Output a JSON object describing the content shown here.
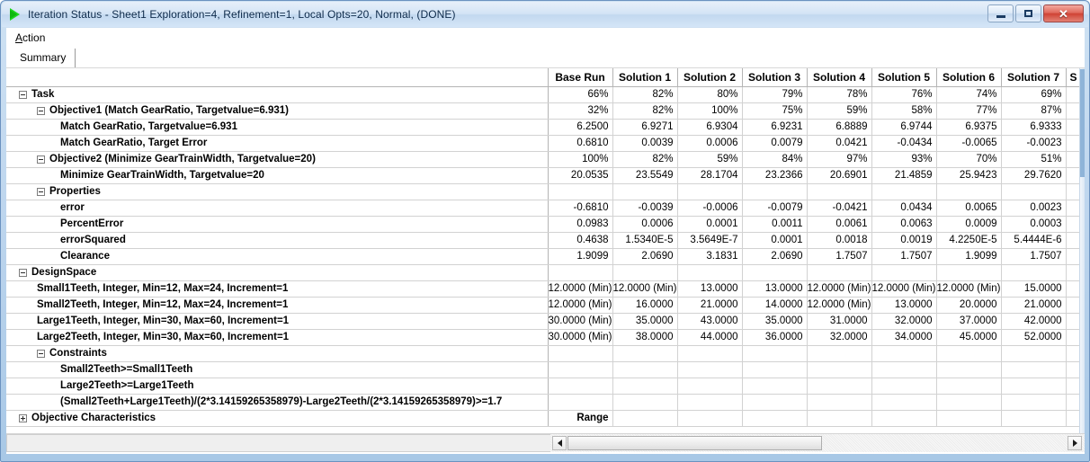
{
  "window": {
    "title": "Iteration Status - Sheet1 Exploration=4, Refinement=1, Local Opts=20, Normal, (DONE)",
    "app_icon": "play-triangle-icon",
    "minimize_label": "–",
    "maximize_label": "□",
    "close_label": "✕"
  },
  "menubar": {
    "items": [
      {
        "label_pre": "",
        "accel": "A",
        "label_post": "ction"
      }
    ]
  },
  "tabs": [
    {
      "label": "Summary",
      "selected": true
    }
  ],
  "grid": {
    "tree_header": "",
    "columns": [
      "Base Run",
      "Solution 1",
      "Solution 2",
      "Solution 3",
      "Solution 4",
      "Solution 5",
      "Solution 6",
      "Solution 7",
      "S"
    ],
    "rows": [
      {
        "label": "Task",
        "indent": 0,
        "expander": "minus",
        "bold": true,
        "values": [
          "66%",
          "82%",
          "80%",
          "79%",
          "78%",
          "76%",
          "74%",
          "69%",
          ""
        ],
        "red": [
          false,
          false,
          false,
          false,
          false,
          false,
          false,
          false,
          false
        ]
      },
      {
        "label": "Objective1 (Match GearRatio, Targetvalue=6.931)",
        "indent": 1,
        "expander": "minus",
        "bold": true,
        "values": [
          "32%",
          "82%",
          "100%",
          "75%",
          "59%",
          "58%",
          "77%",
          "87%",
          ""
        ],
        "red": [
          false,
          false,
          false,
          false,
          false,
          false,
          false,
          false,
          false
        ]
      },
      {
        "label": "Match GearRatio, Targetvalue=6.931",
        "indent": 2,
        "expander": "none",
        "bold": true,
        "values": [
          "6.2500",
          "6.9271",
          "6.9304",
          "6.9231",
          "6.8889",
          "6.9744",
          "6.9375",
          "6.9333",
          ""
        ],
        "red": [
          false,
          false,
          false,
          false,
          false,
          false,
          false,
          false,
          false
        ]
      },
      {
        "label": "Match GearRatio, Target Error",
        "indent": 2,
        "expander": "none",
        "bold": true,
        "values": [
          "0.6810",
          "0.0039",
          "0.0006",
          "0.0079",
          "0.0421",
          "-0.0434",
          "-0.0065",
          "-0.0023",
          ""
        ],
        "red": [
          false,
          false,
          false,
          false,
          false,
          false,
          false,
          false,
          false
        ]
      },
      {
        "label": "Objective2 (Minimize GearTrainWidth, Targetvalue=20)",
        "indent": 1,
        "expander": "minus",
        "bold": true,
        "values": [
          "100%",
          "82%",
          "59%",
          "84%",
          "97%",
          "93%",
          "70%",
          "51%",
          ""
        ],
        "red": [
          false,
          false,
          false,
          false,
          false,
          false,
          false,
          false,
          false
        ]
      },
      {
        "label": "Minimize GearTrainWidth, Targetvalue=20",
        "indent": 2,
        "expander": "none",
        "bold": true,
        "values": [
          "20.0535",
          "23.5549",
          "28.1704",
          "23.2366",
          "20.6901",
          "21.4859",
          "25.9423",
          "29.7620",
          ""
        ],
        "red": [
          false,
          false,
          false,
          false,
          false,
          false,
          false,
          false,
          false
        ]
      },
      {
        "label": "Properties",
        "indent": 1,
        "expander": "minus",
        "bold": true,
        "values": [
          "",
          "",
          "",
          "",
          "",
          "",
          "",
          "",
          ""
        ],
        "red": [
          false,
          false,
          false,
          false,
          false,
          false,
          false,
          false,
          false
        ]
      },
      {
        "label": "error",
        "indent": 2,
        "expander": "none",
        "bold": true,
        "values": [
          "-0.6810",
          "-0.0039",
          "-0.0006",
          "-0.0079",
          "-0.0421",
          "0.0434",
          "0.0065",
          "0.0023",
          ""
        ],
        "red": [
          false,
          false,
          false,
          false,
          false,
          false,
          false,
          false,
          false
        ]
      },
      {
        "label": "PercentError",
        "indent": 2,
        "expander": "none",
        "bold": true,
        "values": [
          "0.0983",
          "0.0006",
          "0.0001",
          "0.0011",
          "0.0061",
          "0.0063",
          "0.0009",
          "0.0003",
          ""
        ],
        "red": [
          false,
          false,
          false,
          false,
          false,
          false,
          false,
          false,
          false
        ]
      },
      {
        "label": "errorSquared",
        "indent": 2,
        "expander": "none",
        "bold": true,
        "values": [
          "0.4638",
          "1.5340E-5",
          "3.5649E-7",
          "0.0001",
          "0.0018",
          "0.0019",
          "4.2250E-5",
          "5.4444E-6",
          ""
        ],
        "red": [
          false,
          false,
          false,
          false,
          false,
          false,
          false,
          false,
          false
        ]
      },
      {
        "label": "Clearance",
        "indent": 2,
        "expander": "none",
        "bold": true,
        "values": [
          "1.9099",
          "2.0690",
          "3.1831",
          "2.0690",
          "1.7507",
          "1.7507",
          "1.9099",
          "1.7507",
          ""
        ],
        "red": [
          false,
          false,
          false,
          false,
          false,
          false,
          false,
          false,
          false
        ]
      },
      {
        "label": "DesignSpace",
        "indent": 0,
        "expander": "minus",
        "bold": true,
        "values": [
          "",
          "",
          "",
          "",
          "",
          "",
          "",
          "",
          ""
        ],
        "red": [
          false,
          false,
          false,
          false,
          false,
          false,
          false,
          false,
          false
        ]
      },
      {
        "label": "Small1Teeth, Integer, Min=12, Max=24, Increment=1",
        "indent": 1,
        "expander": "none",
        "bold": true,
        "values": [
          "12.0000 (Min)",
          "12.0000 (Min)",
          "13.0000",
          "13.0000",
          "12.0000 (Min)",
          "12.0000 (Min)",
          "12.0000 (Min)",
          "15.0000",
          ""
        ],
        "red": [
          true,
          true,
          false,
          false,
          true,
          true,
          true,
          false,
          false
        ]
      },
      {
        "label": "Small2Teeth, Integer, Min=12, Max=24, Increment=1",
        "indent": 1,
        "expander": "none",
        "bold": true,
        "values": [
          "12.0000 (Min)",
          "16.0000",
          "21.0000",
          "14.0000",
          "12.0000 (Min)",
          "13.0000",
          "20.0000",
          "21.0000",
          ""
        ],
        "red": [
          true,
          false,
          false,
          false,
          true,
          false,
          false,
          false,
          false
        ]
      },
      {
        "label": "Large1Teeth, Integer, Min=30, Max=60, Increment=1",
        "indent": 1,
        "expander": "none",
        "bold": true,
        "values": [
          "30.0000 (Min)",
          "35.0000",
          "43.0000",
          "35.0000",
          "31.0000",
          "32.0000",
          "37.0000",
          "42.0000",
          ""
        ],
        "red": [
          true,
          false,
          false,
          false,
          false,
          false,
          false,
          false,
          false
        ]
      },
      {
        "label": "Large2Teeth, Integer, Min=30, Max=60, Increment=1",
        "indent": 1,
        "expander": "none",
        "bold": true,
        "values": [
          "30.0000 (Min)",
          "38.0000",
          "44.0000",
          "36.0000",
          "32.0000",
          "34.0000",
          "45.0000",
          "52.0000",
          ""
        ],
        "red": [
          true,
          false,
          false,
          false,
          false,
          false,
          false,
          false,
          false
        ]
      },
      {
        "label": "Constraints",
        "indent": 1,
        "expander": "minus",
        "bold": true,
        "values": [
          "",
          "",
          "",
          "",
          "",
          "",
          "",
          "",
          ""
        ],
        "red": [
          false,
          false,
          false,
          false,
          false,
          false,
          false,
          false,
          false
        ]
      },
      {
        "label": "Small2Teeth>=Small1Teeth",
        "indent": 2,
        "expander": "none",
        "bold": true,
        "values": [
          "",
          "",
          "",
          "",
          "",
          "",
          "",
          "",
          ""
        ],
        "red": [
          false,
          false,
          false,
          false,
          false,
          false,
          false,
          false,
          false
        ]
      },
      {
        "label": "Large2Teeth>=Large1Teeth",
        "indent": 2,
        "expander": "none",
        "bold": true,
        "values": [
          "",
          "",
          "",
          "",
          "",
          "",
          "",
          "",
          ""
        ],
        "red": [
          false,
          false,
          false,
          false,
          false,
          false,
          false,
          false,
          false
        ]
      },
      {
        "label": "(Small2Teeth+Large1Teeth)/(2*3.14159265358979)-Large2Teeth/(2*3.14159265358979)>=1.7",
        "indent": 2,
        "expander": "none",
        "bold": true,
        "values": [
          "",
          "",
          "",
          "",
          "",
          "",
          "",
          "",
          ""
        ],
        "red": [
          false,
          false,
          false,
          false,
          false,
          false,
          false,
          false,
          false
        ]
      },
      {
        "label": "Objective Characteristics",
        "indent": 0,
        "expander": "plus",
        "bold": true,
        "values": [
          "Range",
          "",
          "",
          "",
          "",
          "",
          "",
          "",
          ""
        ],
        "red": [
          false,
          false,
          false,
          false,
          false,
          false,
          false,
          false,
          false
        ],
        "center": [
          true,
          false,
          false,
          false,
          false,
          false,
          false,
          false,
          false
        ]
      }
    ]
  },
  "scrollbar": {
    "left_arrow": "◀",
    "right_arrow": "▶"
  },
  "colors": {
    "accent_red": "#e01b1b",
    "title_gradient_top": "#e7f0fa",
    "frame_blue": "#a8c8e6",
    "grid_line": "#d2d2d2"
  }
}
